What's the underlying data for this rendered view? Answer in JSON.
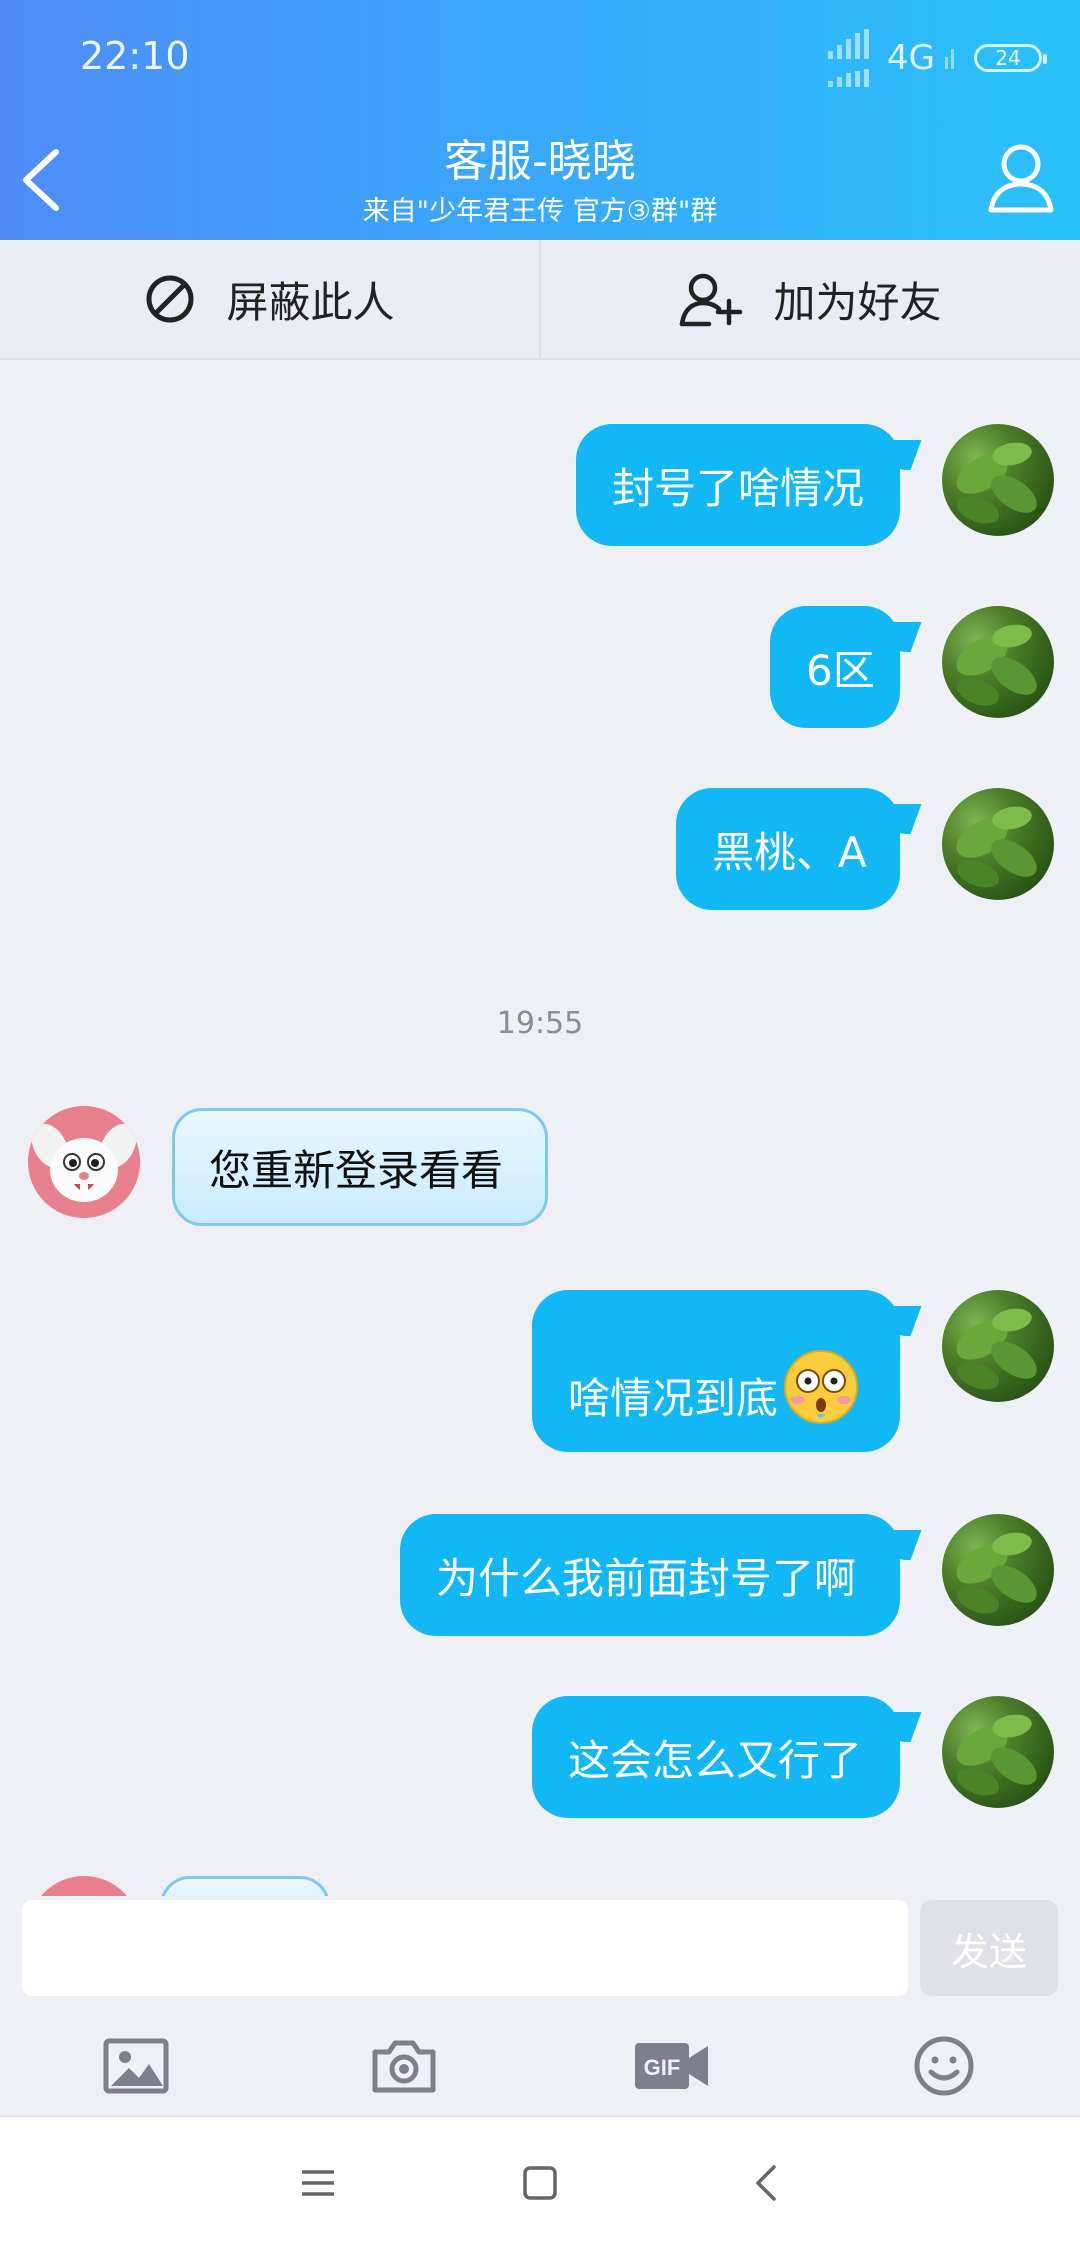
{
  "status_bar": {
    "time": "22:10",
    "network": "4G",
    "battery": "24"
  },
  "header": {
    "title": "客服-晓晓",
    "subtitle": "来自\"少年君王传 官方③群\"群"
  },
  "actions": {
    "block_label": "屏蔽此人",
    "add_friend_label": "加为好友"
  },
  "messages": [
    {
      "side": "right",
      "text": "封号了啥情况"
    },
    {
      "side": "right",
      "text": "6区"
    },
    {
      "side": "right",
      "text": "黑桃、A"
    },
    {
      "type": "timestamp",
      "text": "19:55"
    },
    {
      "side": "left",
      "text": "您重新登录看看"
    },
    {
      "side": "right",
      "text": "啥情况到底",
      "emoji": "shocked-face"
    },
    {
      "side": "right",
      "text": "为什么我前面封号了啊"
    },
    {
      "side": "right",
      "text": "这会怎么又行了"
    }
  ],
  "input": {
    "value": "",
    "send_label": "发送"
  },
  "toolbar": {
    "icons": [
      "image-icon",
      "camera-icon",
      "gif-icon",
      "emoji-icon"
    ]
  },
  "navbar": {
    "icons": [
      "menu-icon",
      "home-icon",
      "back-icon"
    ]
  },
  "colors": {
    "header_start": "#4f8cf8",
    "header_end": "#29c1fb",
    "bubble": "#12b7f5",
    "background": "#eef0f5"
  }
}
